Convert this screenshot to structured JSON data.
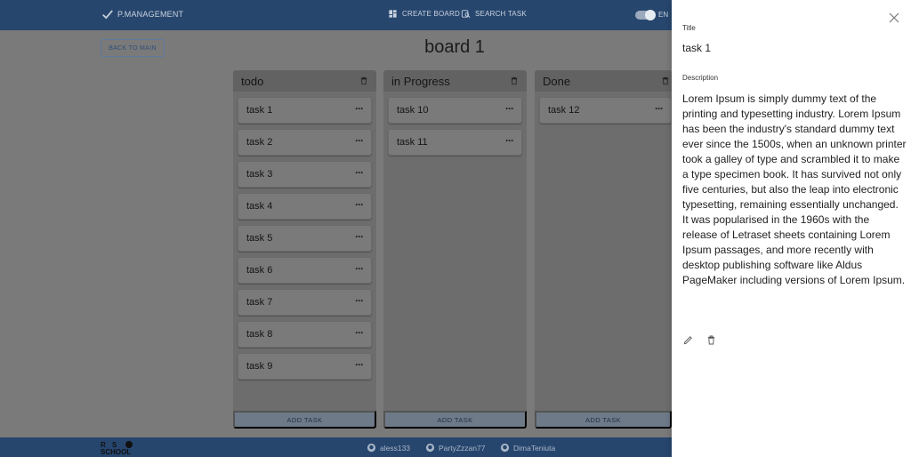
{
  "header": {
    "brand": "P.MANAGEMENT",
    "create_board": "CREATE BOARD",
    "search_task": "SEARCH TASK",
    "language": "EN"
  },
  "main": {
    "back_button": "BACK TO MAIN",
    "board_title": "board 1"
  },
  "columns": [
    {
      "title": "todo",
      "tasks": [
        "task 1",
        "task 2",
        "task 3",
        "task 4",
        "task 5",
        "task 6",
        "task 7",
        "task 8",
        "task 9"
      ],
      "add_label": "ADD TASK"
    },
    {
      "title": "in Progress",
      "tasks": [
        "task 10",
        "task 11"
      ],
      "add_label": "ADD TASK"
    },
    {
      "title": "Done",
      "tasks": [
        "task 12"
      ],
      "add_label": "ADD TASK"
    }
  ],
  "task_menu_glyph": "···",
  "footer": {
    "authors": [
      "aless133",
      "PartyZzzan77",
      "DimaTeniuta"
    ]
  },
  "drawer": {
    "title_label": "Title",
    "title_value": "task 1",
    "description_label": "Description",
    "description_value": "Lorem Ipsum is simply dummy text of the printing and typesetting industry. Lorem Ipsum has been the industry's standard dummy text ever since the 1500s, when an unknown printer took a galley of type and scrambled it to make a type specimen book. It has survived not only five centuries, but also the leap into electronic typesetting, remaining essentially unchanged. It was popularised in the 1960s with the release of Letraset sheets containing Lorem Ipsum passages, and more recently with desktop publishing software like Aldus PageMaker including versions of Lorem Ipsum."
  },
  "colors": {
    "header_bg": "#27466e",
    "overlay_bg": "#7a7a7a",
    "drawer_bg": "#ffffff"
  },
  "icons": [
    "check-icon",
    "dashboard-icon",
    "search-task-icon",
    "trash-icon",
    "more-horizontal-icon",
    "github-icon",
    "close-icon",
    "pencil-icon",
    "rs-school-logo"
  ]
}
